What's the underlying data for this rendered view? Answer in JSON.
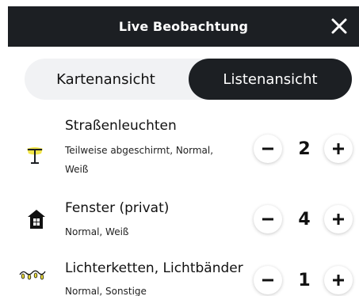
{
  "header": {
    "title": "Live Beobachtung",
    "close_icon": "close-icon"
  },
  "view_toggle": {
    "map_label": "Kartenansicht",
    "list_label": "Listenansicht",
    "selected": "Listenansicht"
  },
  "colors": {
    "dark": "#1c1f23",
    "toggle_bg": "#f1f2f4",
    "lamp_glow": "#f2e64a"
  },
  "items": [
    {
      "title": "Straßenleuchten",
      "subtitle_lines": [
        "Teilweise abgeschirmt, Normal,",
        "Weiß"
      ],
      "count": "2",
      "icon": "street-lamp-icon"
    },
    {
      "title": "Fenster (privat)",
      "subtitle_lines": [
        "Normal, Weiß"
      ],
      "count": "4",
      "icon": "house-window-icon"
    },
    {
      "title": "Lichterketten, Lichtbänder",
      "subtitle_lines": [
        "Normal, Sonstige"
      ],
      "count": "1",
      "icon": "string-lights-icon"
    }
  ]
}
